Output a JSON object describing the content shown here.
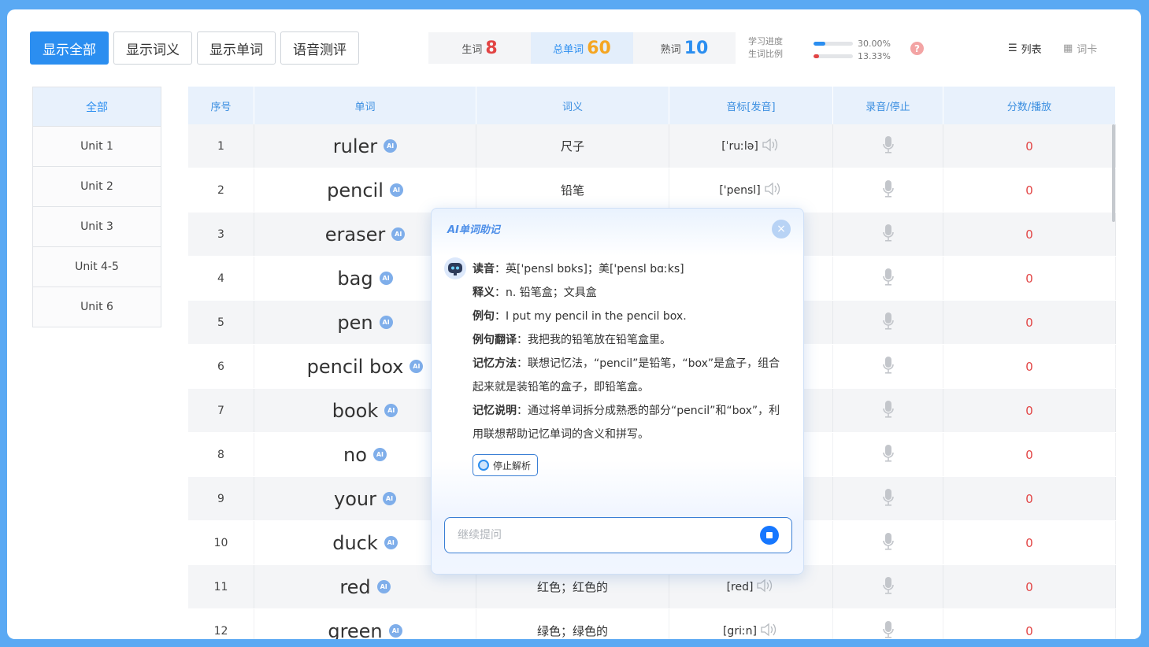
{
  "filters": [
    {
      "label": "显示全部",
      "active": true
    },
    {
      "label": "显示词义",
      "active": false
    },
    {
      "label": "显示单词",
      "active": false
    },
    {
      "label": "语音测评",
      "active": false
    }
  ],
  "counts": {
    "new_label": "生词",
    "new_value": "8",
    "total_label": "总单词",
    "total_value": "60",
    "known_label": "熟词",
    "known_value": "10"
  },
  "progress": {
    "label_study": "学习进度",
    "label_new_ratio": "生词比例",
    "study_percent": "30.00%",
    "study_value": 30.0,
    "new_ratio_percent": "13.33%",
    "new_ratio_value": 13.33
  },
  "view_switch": {
    "list_label": "列表",
    "card_label": "词卡"
  },
  "sidebar": {
    "items": [
      "全部",
      "Unit 1",
      "Unit 2",
      "Unit 3",
      "Unit 4-5",
      "Unit 6"
    ]
  },
  "table": {
    "headers": [
      "序号",
      "单词",
      "词义",
      "音标[发音]",
      "录音/停止",
      "分数/播放"
    ],
    "rows": [
      {
        "idx": "1",
        "word": "ruler",
        "meaning": "尺子",
        "phonetic": "[ˈruːlə]",
        "score": "0"
      },
      {
        "idx": "2",
        "word": "pencil",
        "meaning": "铅笔",
        "phonetic": "['pensl]",
        "score": "0"
      },
      {
        "idx": "3",
        "word": "eraser",
        "meaning": "",
        "phonetic": "",
        "score": "0"
      },
      {
        "idx": "4",
        "word": "bag",
        "meaning": "",
        "phonetic": "",
        "score": "0"
      },
      {
        "idx": "5",
        "word": "pen",
        "meaning": "",
        "phonetic": "",
        "score": "0"
      },
      {
        "idx": "6",
        "word": "pencil box",
        "meaning": "",
        "phonetic": "",
        "score": "0"
      },
      {
        "idx": "7",
        "word": "book",
        "meaning": "",
        "phonetic": "",
        "score": "0"
      },
      {
        "idx": "8",
        "word": "no",
        "meaning": "",
        "phonetic": "",
        "score": "0"
      },
      {
        "idx": "9",
        "word": "your",
        "meaning": "",
        "phonetic": "",
        "score": "0"
      },
      {
        "idx": "10",
        "word": "duck",
        "meaning": "",
        "phonetic": "",
        "score": "0"
      },
      {
        "idx": "11",
        "word": "red",
        "meaning": "红色；红色的",
        "phonetic": "[red]",
        "score": "0"
      },
      {
        "idx": "12",
        "word": "green",
        "meaning": "绿色；绿色的",
        "phonetic": "[griːn]",
        "score": "0"
      }
    ]
  },
  "ai_badge": "AI",
  "popup": {
    "title": "AI单词助记",
    "close": "×",
    "reading_label": "读音",
    "reading": "：英['pensl bɒks]；美['pensl bɑːks]",
    "meaning_label": "释义",
    "meaning": "：n. 铅笔盒；文具盒",
    "example_label": "例句",
    "example": "：I put my pencil in the pencil box.",
    "translation_label": "例句翻译",
    "translation": "：我把我的铅笔放在铅笔盒里。",
    "method_label": "记忆方法",
    "method": "：联想记忆法，“pencil”是铅笔，“box”是盒子，组合起来就是装铅笔的盒子，即铅笔盒。",
    "note_label": "记忆说明",
    "note": "：通过将单词拆分成熟悉的部分“pencil”和“box”，利用联想帮助记忆单词的含义和拼写。",
    "stop_label": "停止解析",
    "ask_placeholder": "继续提问"
  },
  "colors": {
    "accent": "#2b8ef0",
    "new_count": "#e24444",
    "total_count": "#f5a623",
    "known_count": "#2b8ef0",
    "study_bar": "#2b8ef0",
    "new_ratio_bar": "#e24444",
    "score": "#e24444"
  }
}
